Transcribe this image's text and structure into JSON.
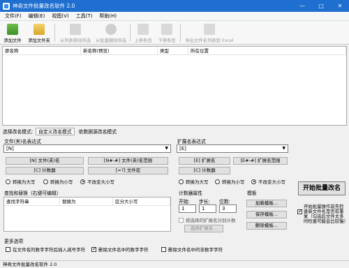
{
  "window": {
    "title": "神奇文件批量改名软件 2.0"
  },
  "menu": [
    "文件(F)",
    "编辑(E)",
    "视图(V)",
    "工具(T)",
    "帮助(H)"
  ],
  "toolbar": {
    "add_file": "添加文件",
    "add_folder": "添加文件夹",
    "remove_selected": "从列表移除所选",
    "remove_all": "从批量删除所选",
    "move_up": "上移条目",
    "move_down": "下移条目",
    "export_excel": "导出文件名列表到 Excel"
  },
  "list": {
    "columns": [
      "原名称",
      "新名称(预览)",
      "类型",
      "所在位置"
    ]
  },
  "mode": {
    "label": "选择改名模式:",
    "tab_custom": "自定义改名模式",
    "tab_template": "依数据源改名模式"
  },
  "name_expr": {
    "label": "文件(夹)名表达式",
    "value": "[N]",
    "btn_name": "[N] 文件(夹)名",
    "btn_range": "[N#-#] 文件(夹)名范围",
    "btn_counter": "[C] 计数器",
    "btn_macro": "[=?] 文件宏",
    "case_upper": "转换为大写",
    "case_lower": "转换为小写",
    "case_keep": "不改变大小写"
  },
  "ext_expr": {
    "label": "扩展名表达式",
    "value": "[E]",
    "btn_ext": "[E] 扩展名",
    "btn_range": "[E#-#] 扩展名范围",
    "btn_counter": "[C] 计数器",
    "case_upper": "转换为大写",
    "case_lower": "转换为小写",
    "case_keep": "不改变大小写"
  },
  "start": {
    "label": "开始批量改名",
    "check_note": "开始批量操作前先检查新文件名是否有重复（勾选后文件太多时检查可能会比较慢）"
  },
  "find_replace": {
    "label": "查找和替换（右键可编辑）",
    "columns": [
      "查找字符串",
      "替换为",
      "区分大小写"
    ]
  },
  "counter": {
    "label": "计数器属性",
    "start_label": "开始:",
    "step_label": "步长:",
    "digits_label": "位数:",
    "start": "1",
    "step": "1",
    "digits": "3",
    "per_ext": "按选择的扩展名分别计数",
    "select_ext": "选择扩展名..."
  },
  "templates": {
    "label": "模板",
    "load": "加载模板...",
    "save": "保存模板...",
    "delete": "删除模板..."
  },
  "more": {
    "label": "更多选项",
    "opt1": "在文件名的数字字符后插入减号字符",
    "opt2": "删除文件名中的数字字符",
    "opt3": "删除文件名中的非数字字符"
  },
  "status": {
    "text": "神奇文件批量改名软件 2.0"
  },
  "colors": {
    "titlebar": "#1f6fd0",
    "accent": "#3a8ee6"
  }
}
